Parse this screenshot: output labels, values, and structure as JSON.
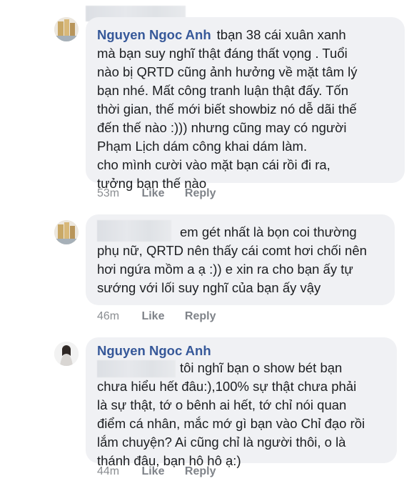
{
  "comments": [
    {
      "author": "Nguyen Ngoc Anh",
      "lines": [
        "tbạn 38 cái xuân xanh",
        "mà bạn suy nghĩ thật đáng thất vọng . Tuổi",
        "nào bị QRTD cũng ảnh hưởng về mặt tâm lý",
        "bạn nhé. Mất công tranh luận thật đấy. Tốn",
        "thời gian, thế mới biết showbiz nó dễ dãi thế",
        "đến thế nào :))) nhưng cũng may có người",
        "Phạm Lịch dám công khai dám làm.",
        " cho mình cười vào mặt bạn cái rồi đi ra,",
        "tưởng bạn thế nào"
      ],
      "time": "53m",
      "like": "Like",
      "reply": "Reply"
    },
    {
      "author": "",
      "lines": [
        "em gét nhất là bọn coi thường",
        "phụ nữ, QRTD nên thấy cái comt hơi chối nên",
        "hơi ngứa mồm a ạ :)) e xin ra cho bạn ấy tự",
        "sướng với lối suy nghĩ của bạn ấy vậy"
      ],
      "time": "46m",
      "like": "Like",
      "reply": "Reply"
    },
    {
      "author": "Nguyen Ngoc Anh",
      "lines": [
        "tôi nghĩ bạn o show bét bạn",
        "chưa hiểu hết đâu:),100% sự thật chưa phải",
        "là sự thật, tớ o bênh ai hết, tớ chỉ nói quan",
        "điểm cá nhân, mắc mớ gì bạn vào Chỉ đạo rồi",
        "lắm chuyện? Ai cũng chỉ là người thôi, o là",
        "thánh đâu, bạn hô hô ạ:)"
      ],
      "time": "44m",
      "like": "Like",
      "reply": "Reply"
    }
  ]
}
